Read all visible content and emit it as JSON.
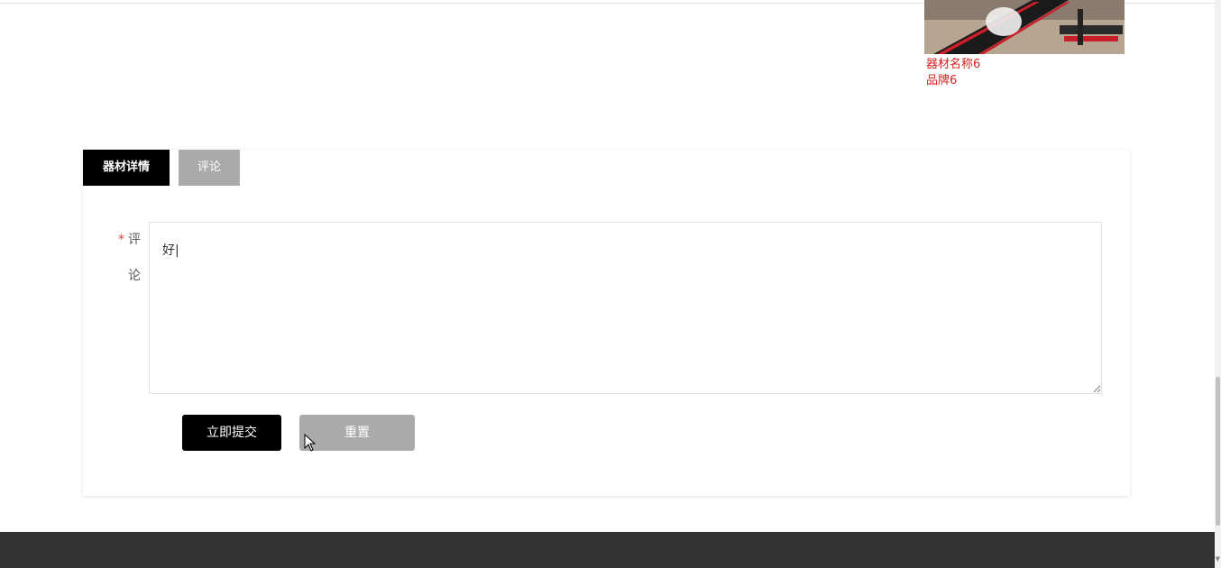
{
  "product": {
    "name": "器材名称6",
    "brand": "品牌6",
    "image_icon": "fitness-bench-image"
  },
  "tabs": [
    {
      "label": "器材详情",
      "active": true
    },
    {
      "label": "评论",
      "active": false
    }
  ],
  "comment_form": {
    "required_mark": "*",
    "label": "评论",
    "value": "好|"
  },
  "buttons": {
    "submit_label": "立即提交",
    "reset_label": "重置"
  },
  "colors": {
    "accent": "#000000",
    "product_text": "#d61e1e",
    "inactive": "#aaaaaa",
    "footer": "#333333",
    "required": "#e23c3c"
  }
}
